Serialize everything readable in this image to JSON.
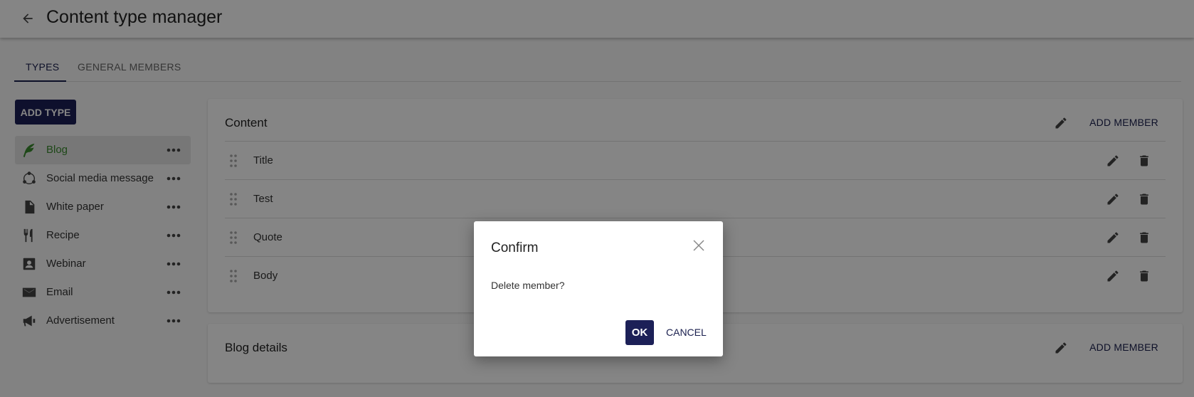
{
  "header": {
    "back_icon": "arrow-left-icon",
    "title": "Content type manager"
  },
  "tabs": [
    {
      "label": "TYPES",
      "active": true
    },
    {
      "label": "GENERAL MEMBERS",
      "active": false
    }
  ],
  "sidebar": {
    "add_type_label": "ADD TYPE",
    "items": [
      {
        "label": "Blog",
        "icon": "feather-icon",
        "active": true
      },
      {
        "label": "Social media message",
        "icon": "share-network-icon",
        "active": false
      },
      {
        "label": "White paper",
        "icon": "document-icon",
        "active": false
      },
      {
        "label": "Recipe",
        "icon": "fork-knife-icon",
        "active": false
      },
      {
        "label": "Webinar",
        "icon": "person-badge-icon",
        "active": false
      },
      {
        "label": "Email",
        "icon": "envelope-icon",
        "active": false
      },
      {
        "label": "Advertisement",
        "icon": "megaphone-icon",
        "active": false
      }
    ]
  },
  "content_card": {
    "title": "Content",
    "add_member_label": "ADD MEMBER",
    "members": [
      {
        "label": "Title"
      },
      {
        "label": "Test"
      },
      {
        "label": "Quote"
      },
      {
        "label": "Body"
      }
    ]
  },
  "blog_details_card": {
    "title": "Blog details",
    "add_member_label": "ADD MEMBER"
  },
  "dialog": {
    "title": "Confirm",
    "message": "Delete member?",
    "ok_label": "OK",
    "cancel_label": "CANCEL"
  },
  "colors": {
    "primary": "#1c2057",
    "active_item": "#3a8a2e",
    "overlay": "rgba(0,0,0,0.48)"
  }
}
